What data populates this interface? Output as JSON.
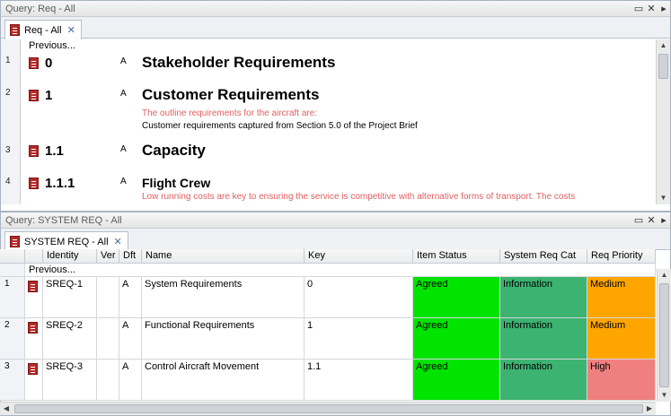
{
  "top_panel": {
    "title": "Query: Req - All",
    "tab_label": "Req - All",
    "previous_label": "Previous...",
    "entries": [
      {
        "row": "1",
        "level": "0",
        "flag": "A",
        "title": "Stakeholder Requirements",
        "note": "",
        "desc": ""
      },
      {
        "row": "2",
        "level": "1",
        "flag": "A",
        "title": "Customer Requirements",
        "note": "The outline requirements for the aircraft are:",
        "desc": "Customer requirements captured from Section 5.0 of the Project Brief"
      },
      {
        "row": "3",
        "level": "1.1",
        "flag": "A",
        "title": "Capacity",
        "note": "",
        "desc": ""
      },
      {
        "row": "4",
        "level": "1.1.1",
        "flag": "A",
        "title": "Flight Crew",
        "note": "Low running costs are key to ensuring the service is competitive with alternative forms of transport.  The costs",
        "desc": ""
      }
    ]
  },
  "bottom_panel": {
    "title": "Query: SYSTEM REQ - All",
    "tab_label": "SYSTEM REQ - All",
    "previous_label": "Previous...",
    "columns": [
      "Identity",
      "Ver",
      "Dft",
      "Name",
      "Key",
      "Item Status",
      "System Req Cat",
      "Req Priority"
    ],
    "rows": [
      {
        "row": "1",
        "identity": "SREQ-1",
        "ver": "",
        "dft": "A",
        "name": "System Requirements",
        "key": "0",
        "status": "Agreed",
        "cat": "Information",
        "priority": "Medium"
      },
      {
        "row": "2",
        "identity": "SREQ-2",
        "ver": "",
        "dft": "A",
        "name": "Functional Requirements",
        "key": "1",
        "status": "Agreed",
        "cat": "Information",
        "priority": "Medium"
      },
      {
        "row": "3",
        "identity": "SREQ-3",
        "ver": "",
        "dft": "A",
        "name": "Control Aircraft Movement",
        "key": "1.1",
        "status": "Agreed",
        "cat": "Information",
        "priority": "High"
      }
    ]
  },
  "colors": {
    "agreed": "#00e400",
    "information": "#3cb371",
    "medium": "#ffa500",
    "high": "#f08080",
    "note_text": "#e06060"
  },
  "icons": {
    "restore": "restore-icon",
    "close": "close-icon",
    "scroll_right": "scroll-right-icon",
    "requirement": "requirement-doc-icon"
  }
}
